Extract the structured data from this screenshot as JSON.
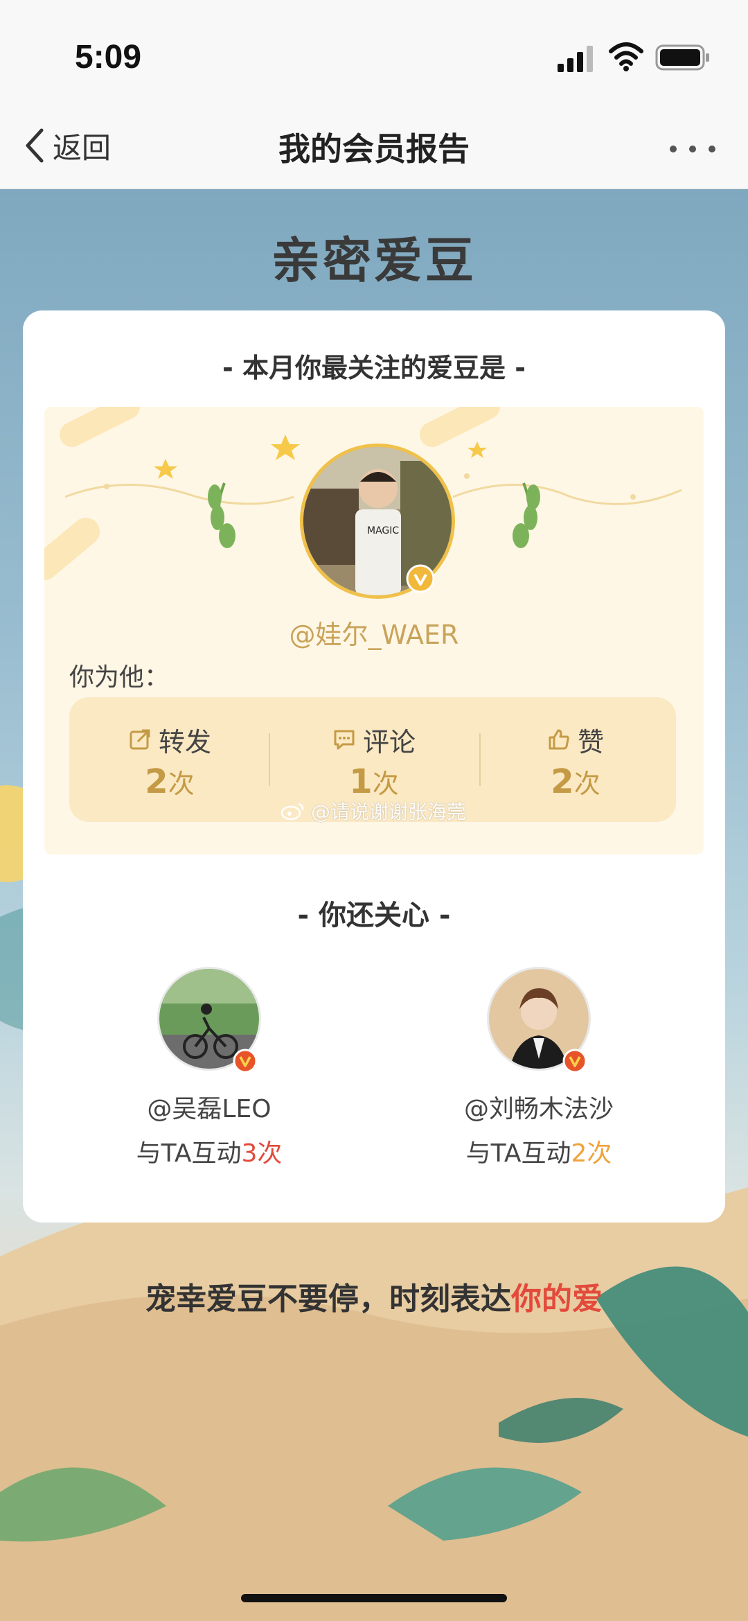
{
  "status_bar": {
    "time": "5:09"
  },
  "nav": {
    "back_label": "返回",
    "title": "我的会员报告"
  },
  "heading": "亲密爱豆",
  "card": {
    "subtitle": "-  本月你最关注的爱豆是  -",
    "idol": {
      "name": "@娃尔_WAER"
    },
    "you_for_him": "你为他：",
    "stats": [
      {
        "label": "转发",
        "icon": "repost-icon",
        "value": "2",
        "unit": "次"
      },
      {
        "label": "评论",
        "icon": "comment-icon",
        "value": "1",
        "unit": "次"
      },
      {
        "label": "赞",
        "icon": "like-icon",
        "value": "2",
        "unit": "次"
      }
    ],
    "watermark": "@请说谢谢张海莞",
    "also_care_title": "-  你还关心  -",
    "friends": [
      {
        "name": "@吴磊LEO",
        "interact_prefix": "与TA互动",
        "count": "3次"
      },
      {
        "name": "@刘畅木法沙",
        "interact_prefix": "与TA互动",
        "count": "2次"
      }
    ]
  },
  "footer": {
    "slogan_prefix": "宠幸爱豆不要停，时刻表达",
    "slogan_highlight": "你的爱"
  },
  "colors": {
    "accent_gold": "#c59a45",
    "highlight_red": "#e24a3b",
    "highlight_orange": "#f0a33a",
    "panel_cream": "#fff7e6",
    "stats_bg": "#fbe9c4"
  }
}
